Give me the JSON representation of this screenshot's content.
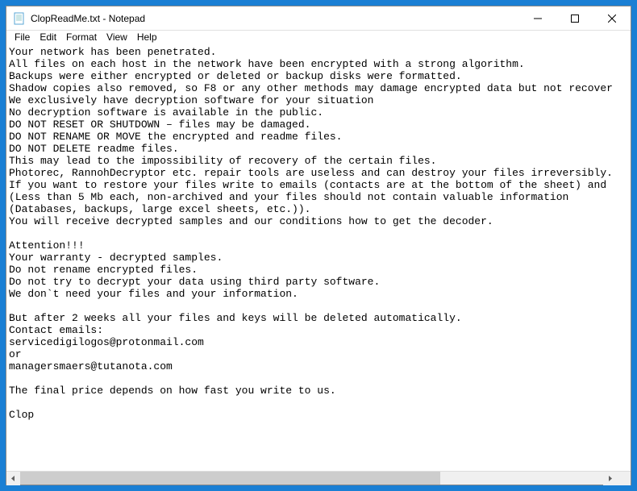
{
  "window": {
    "title": "ClopReadMe.txt - Notepad",
    "controls": {
      "min": "—",
      "max": "☐",
      "close": "✕"
    }
  },
  "menu": {
    "file": "File",
    "edit": "Edit",
    "format": "Format",
    "view": "View",
    "help": "Help"
  },
  "body_lines": [
    "Your network has been penetrated.",
    "All files on each host in the network have been encrypted with a strong algorithm.",
    "Backups were either encrypted or deleted or backup disks were formatted.",
    "Shadow copies also removed, so F8 or any other methods may damage encrypted data but not recover",
    "We exclusively have decryption software for your situation",
    "No decryption software is available in the public.",
    "DO NOT RESET OR SHUTDOWN – files may be damaged.",
    "DO NOT RENAME OR MOVE the encrypted and readme files.",
    "DO NOT DELETE readme files.",
    "This may lead to the impossibility of recovery of the certain files.",
    "Photorec, RannohDecryptor etc. repair tools are useless and can destroy your files irreversibly.",
    "If you want to restore your files write to emails (contacts are at the bottom of the sheet) and ",
    "(Less than 5 Mb each, non-archived and your files should not contain valuable information",
    "(Databases, backups, large excel sheets, etc.)).",
    "You will receive decrypted samples and our conditions how to get the decoder.",
    "",
    "Attention!!!",
    "Your warranty - decrypted samples.",
    "Do not rename encrypted files.",
    "Do not try to decrypt your data using third party software.",
    "We don`t need your files and your information.",
    "",
    "But after 2 weeks all your files and keys will be deleted automatically.",
    "Contact emails:",
    "servicedigilogos@protonmail.com",
    "or",
    "managersmaers@tutanota.com",
    "",
    "The final price depends on how fast you write to us.",
    "",
    "Clop"
  ],
  "scrollbar": {
    "left_arrow": "◀",
    "right_arrow": "▶"
  }
}
